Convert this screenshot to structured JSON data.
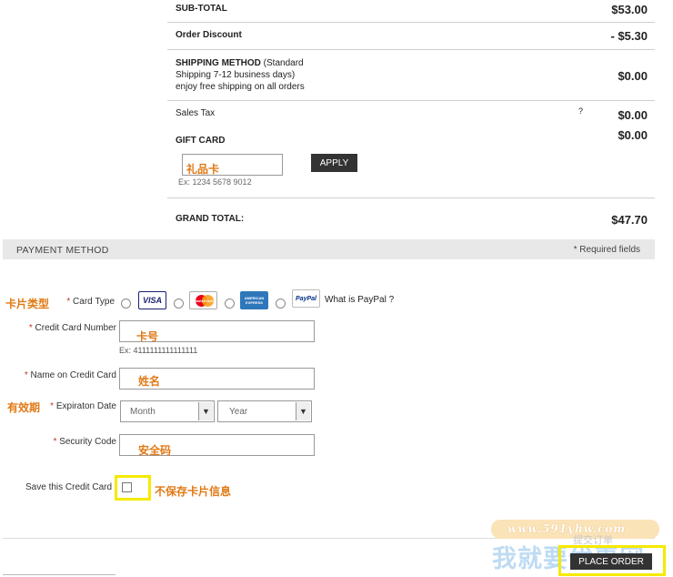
{
  "summary": {
    "subtotal_label": "SUB-TOTAL",
    "subtotal_value": "$53.00",
    "discount_label": "Order Discount",
    "discount_value": "- $5.30",
    "shipping_label_bold": "SHIPPING METHOD",
    "shipping_label_rest": " (Standard",
    "shipping_line2": "Shipping 7-12 business days)",
    "shipping_line3": "enjoy free shipping on all orders",
    "shipping_value": "$0.00",
    "tax_label": "Sales Tax",
    "tax_help": "?",
    "tax_value": "$0.00",
    "gift_label": "GIFT CARD",
    "gift_value": "$0.00",
    "gift_annotation": "礼品卡",
    "gift_apply": "APPLY",
    "gift_example": "Ex: 1234 5678 9012",
    "grand_label": "GRAND TOTAL:",
    "grand_value": "$47.70"
  },
  "payment": {
    "header": "PAYMENT METHOD",
    "required_note": "* Required fields",
    "card_type_annotation": "卡片类型",
    "card_type_label": "Card Type",
    "cards": [
      "VISA",
      "MasterCard",
      "AMERICAN EXPRESS",
      "PayPal"
    ],
    "paypal_link": "What is PayPal ?",
    "cc_number_label": "Credit Card Number",
    "cc_number_annotation": "卡号",
    "cc_number_example": "Ex: 4111111111111111",
    "name_label": "Name on Credit Card",
    "name_annotation": "姓名",
    "expiry_annotation": "有效期",
    "expiry_label": "Expiraton Date",
    "month_selected": "Month",
    "year_selected": "Year",
    "security_label": "Security Code",
    "security_annotation": "安全码",
    "save_label": "Save this Credit Card",
    "save_annotation": "不保存卡片信息",
    "required_star": "*"
  },
  "footer": {
    "place_order_annotation": "提交订单",
    "place_order": "PLACE ORDER",
    "watermark_url": "www.591yhw.com",
    "watermark_name": "我就要优惠网"
  },
  "colors": {
    "annotation": "#e07a16",
    "highlight": "#f5ea00",
    "required": "#c0392b",
    "button": "#333333"
  }
}
